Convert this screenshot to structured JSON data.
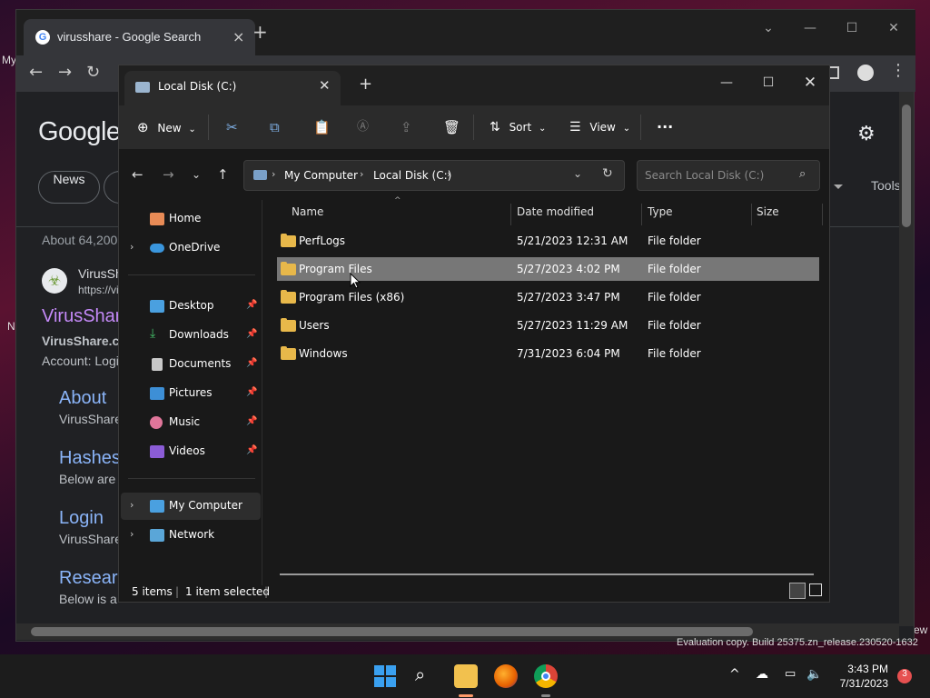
{
  "chrome": {
    "tab_title": "virusshare - Google Search",
    "google_logo": "Google",
    "news_chip": "News",
    "tools": "Tools",
    "about_results": "About 64,200",
    "result_site": "VirusSh",
    "result_url": "https://vi",
    "result_title": "VirusShar",
    "result_snippet_1": "VirusShare.c",
    "result_snippet_2": "Account: Logi",
    "sublinks": [
      {
        "title": "About",
        "desc": "VirusShare"
      },
      {
        "title": "Hashes",
        "desc": "Below are"
      },
      {
        "title": "Login",
        "desc": "VirusShare"
      },
      {
        "title": "Resear",
        "desc": "Below is a"
      }
    ],
    "left_edge_my": "My",
    "left_edge_n": "N",
    "right_edge_ew": "ew"
  },
  "explorer": {
    "tab_title": "Local Disk (C:)",
    "commands": {
      "new": "New",
      "sort": "Sort",
      "view": "View"
    },
    "breadcrumb": [
      "My Computer",
      "Local Disk (C:)"
    ],
    "search_placeholder": "Search Local Disk (C:)",
    "nav": {
      "home": "Home",
      "onedrive": "OneDrive",
      "desktop": "Desktop",
      "downloads": "Downloads",
      "documents": "Documents",
      "pictures": "Pictures",
      "music": "Music",
      "videos": "Videos",
      "mycomputer": "My Computer",
      "network": "Network"
    },
    "columns": {
      "name": "Name",
      "date": "Date modified",
      "type": "Type",
      "size": "Size"
    },
    "rows": [
      {
        "name": "PerfLogs",
        "date": "5/21/2023 12:31 AM",
        "type": "File folder"
      },
      {
        "name": "Program Files",
        "date": "5/27/2023 4:02 PM",
        "type": "File folder"
      },
      {
        "name": "Program Files (x86)",
        "date": "5/27/2023 3:47 PM",
        "type": "File folder"
      },
      {
        "name": "Users",
        "date": "5/27/2023 11:29 AM",
        "type": "File folder"
      },
      {
        "name": "Windows",
        "date": "7/31/2023 6:04 PM",
        "type": "File folder"
      }
    ],
    "status": {
      "items": "5 items",
      "selected": "1 item selected"
    }
  },
  "desktop": {
    "eval_text": "Evaluation copy. Build 25375.zn_release.230520-1632"
  },
  "taskbar": {
    "time": "3:43 PM",
    "date": "7/31/2023",
    "notifications": "3"
  },
  "colors": {
    "selection": "#777777",
    "folder": "#e8b84a",
    "link": "#8ab4f8"
  }
}
